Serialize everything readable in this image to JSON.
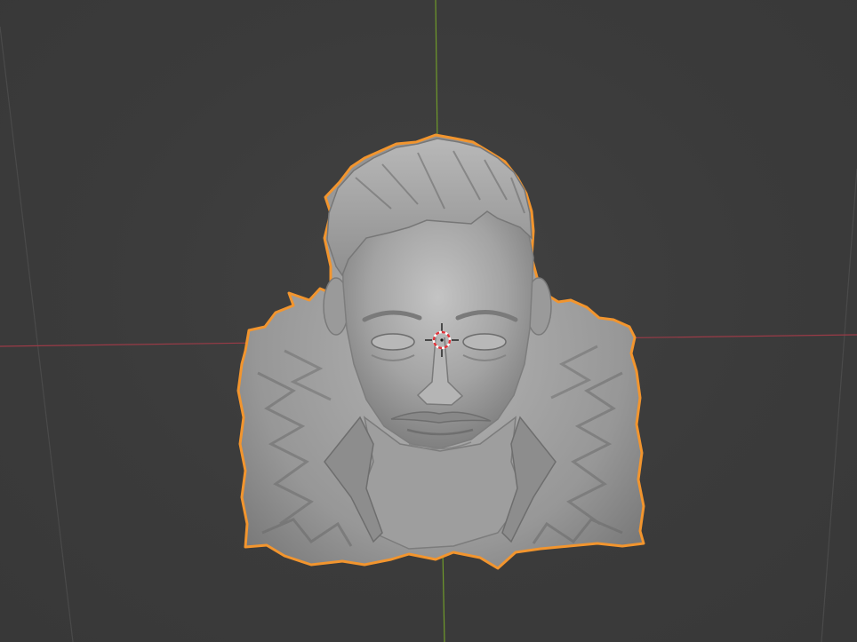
{
  "app": {
    "editor": "3d-viewport",
    "object_selected": true
  },
  "colors": {
    "background": "#3d3d3d",
    "grid_line": "#4a4a4a",
    "axis_x": "#9a3b47",
    "axis_y": "#6f9a2a",
    "selection_outline": "#f2952e",
    "model_base": "#9c9c9c",
    "model_light": "#c7c7c7",
    "model_shadow": "#6a6a6a",
    "cursor_red": "#e0343b",
    "cursor_white": "#ffffff"
  },
  "icons": {
    "cursor": "3d-cursor-icon"
  }
}
